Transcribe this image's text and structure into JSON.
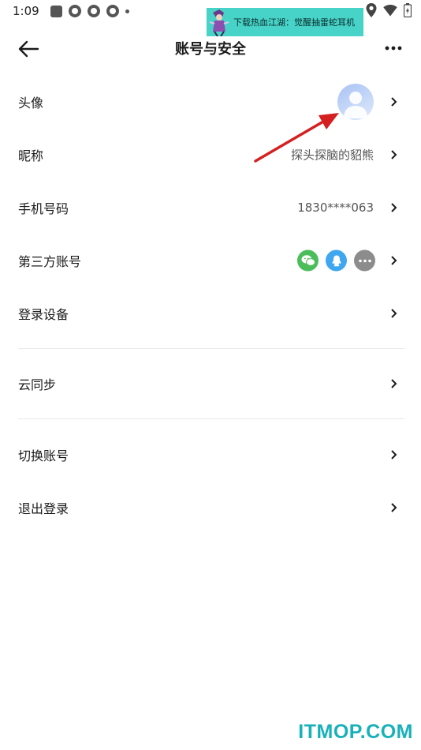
{
  "status_bar": {
    "time": "1:09"
  },
  "banner": {
    "text": "下载热血江湖：觉醒抽雷蛇耳机"
  },
  "header": {
    "title": "账号与安全"
  },
  "rows": [
    {
      "label": "头像"
    },
    {
      "label": "昵称",
      "value": "探头探脑的貂熊"
    },
    {
      "label": "手机号码",
      "value": "1830****063"
    },
    {
      "label": "第三方账号",
      "icons": [
        "wechat-icon",
        "qq-icon",
        "more-icon"
      ]
    },
    {
      "label": "登录设备"
    },
    {
      "label": "云同步"
    },
    {
      "label": "切换账号"
    },
    {
      "label": "退出登录"
    }
  ],
  "watermark": {
    "text": "ITMOP.COM"
  },
  "colors": {
    "wechat": "#4bbd5b",
    "qq": "#3ea7f0",
    "more": "#8c8c8c",
    "banner": "#47d3c8",
    "arrow": "#d42020",
    "watermark": "#19b1b9"
  }
}
